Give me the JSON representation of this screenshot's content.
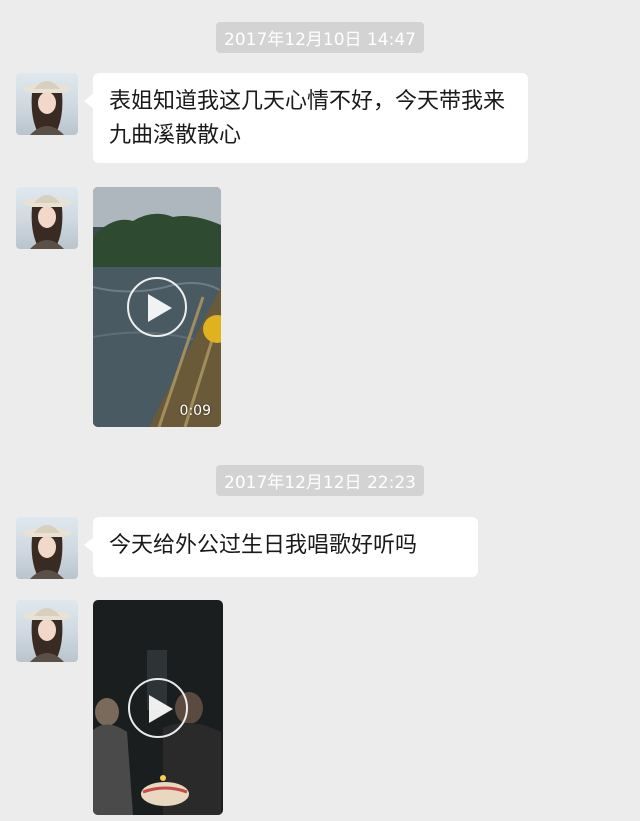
{
  "chat": {
    "timestamps": [
      "2017年12月10日 14:47",
      "2017年12月12日 22:23"
    ],
    "messages": [
      {
        "type": "text",
        "text": "表姐知道我这几天心情不好，今天带我来九曲溪散散心"
      },
      {
        "type": "video",
        "duration": "0:09"
      },
      {
        "type": "text",
        "text": "今天给外公过生日我唱歌好听吗"
      },
      {
        "type": "video",
        "duration": ""
      }
    ]
  }
}
